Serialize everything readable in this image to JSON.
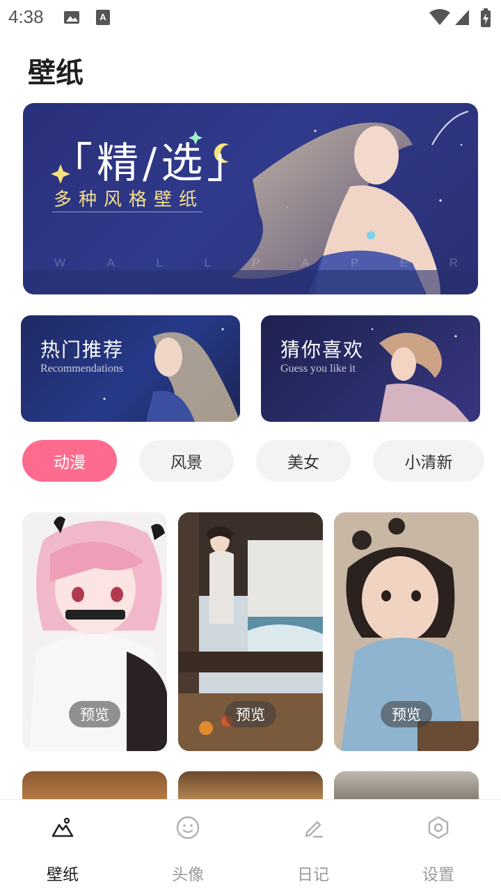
{
  "status_bar": {
    "time": "4:38"
  },
  "page": {
    "title": "壁纸"
  },
  "hero": {
    "title": "「精/选」",
    "subtitle": "多种风格壁纸",
    "watermark": [
      "W",
      "A",
      "L",
      "L",
      "P",
      "A",
      "P",
      "E",
      "R"
    ]
  },
  "cards": [
    {
      "title": "热门推荐",
      "subtitle": "Recommendations"
    },
    {
      "title": "猜你喜欢",
      "subtitle": "Guess you like it"
    }
  ],
  "categories": [
    {
      "label": "动漫",
      "active": true
    },
    {
      "label": "风景",
      "active": false
    },
    {
      "label": "美女",
      "active": false
    },
    {
      "label": "小清新",
      "active": false
    }
  ],
  "grid": {
    "preview_label": "预览"
  },
  "nav": [
    {
      "label": "壁纸",
      "icon": "mountain-icon",
      "active": true
    },
    {
      "label": "头像",
      "icon": "smile-icon",
      "active": false
    },
    {
      "label": "日记",
      "icon": "pencil-icon",
      "active": false
    },
    {
      "label": "设置",
      "icon": "settings-icon",
      "active": false
    }
  ],
  "colors": {
    "accent": "#ff6b8e",
    "hero_bg": "#2f3788"
  }
}
